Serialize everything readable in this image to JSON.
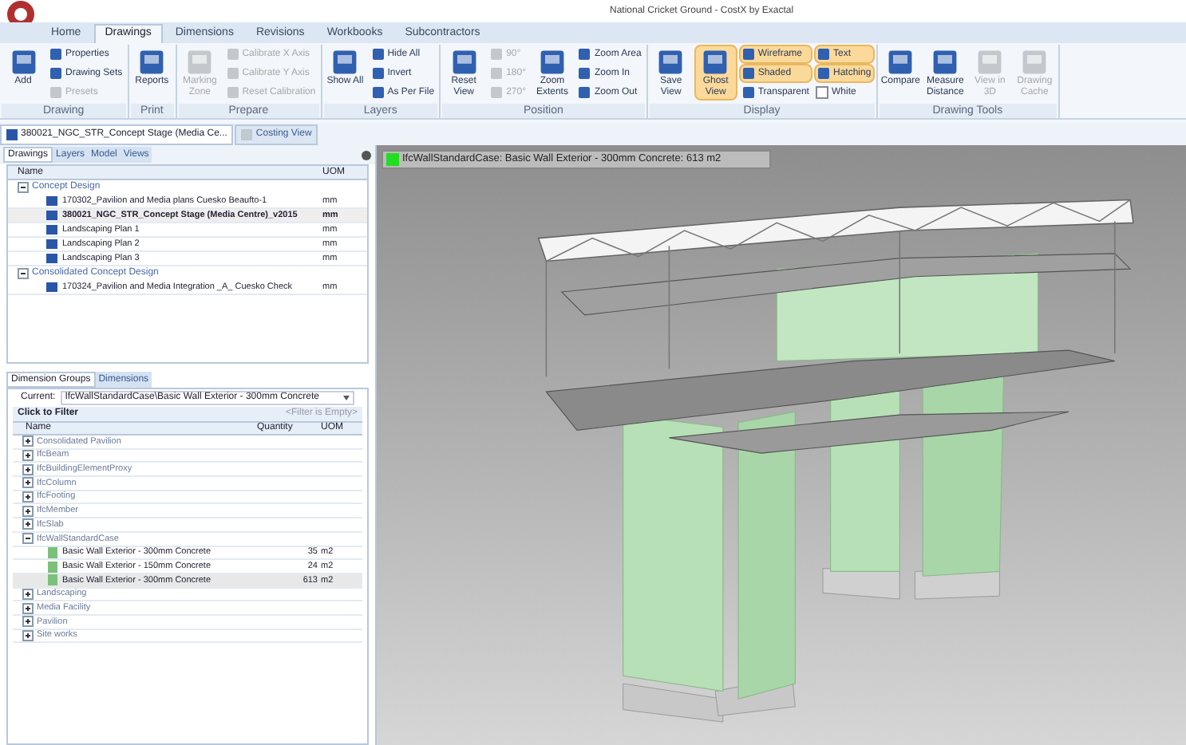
{
  "window": {
    "title": "National Cricket Ground - CostX by Exactal"
  },
  "ribbon_tabs": [
    {
      "label": "Home",
      "selected": false
    },
    {
      "label": "Drawings",
      "selected": true
    },
    {
      "label": "Dimensions",
      "selected": false
    },
    {
      "label": "Revisions",
      "selected": false
    },
    {
      "label": "Workbooks",
      "selected": false
    },
    {
      "label": "Subcontractors",
      "selected": false
    }
  ],
  "ribbon_groups": [
    {
      "label": "Drawing",
      "items": [
        {
          "kind": "large",
          "label": "Add",
          "disabled": false,
          "active": false
        },
        {
          "kind": "small",
          "label": "Properties",
          "disabled": false,
          "active": false
        },
        {
          "kind": "small",
          "label": "Drawing Sets",
          "disabled": false,
          "active": false
        },
        {
          "kind": "small",
          "label": "Presets",
          "disabled": true,
          "active": false
        }
      ]
    },
    {
      "label": "Print",
      "items": [
        {
          "kind": "large",
          "label": "Reports",
          "disabled": false,
          "active": false
        }
      ]
    },
    {
      "label": "Prepare",
      "items": [
        {
          "kind": "large",
          "label": "Marking Zone",
          "disabled": true,
          "active": false
        },
        {
          "kind": "small",
          "label": "Calibrate X Axis",
          "disabled": true,
          "active": false
        },
        {
          "kind": "small",
          "label": "Calibrate Y Axis",
          "disabled": true,
          "active": false
        },
        {
          "kind": "small",
          "label": "Reset Calibration",
          "disabled": true,
          "active": false
        }
      ]
    },
    {
      "label": "Layers",
      "items": [
        {
          "kind": "large",
          "label": "Show All",
          "disabled": false,
          "active": false
        },
        {
          "kind": "small",
          "label": "Hide All",
          "disabled": false,
          "active": false
        },
        {
          "kind": "small",
          "label": "Invert",
          "disabled": false,
          "active": false
        },
        {
          "kind": "small",
          "label": "As Per File",
          "disabled": false,
          "active": false
        }
      ]
    },
    {
      "label": "Position",
      "items": [
        {
          "kind": "large",
          "label": "Reset View",
          "disabled": false,
          "active": false
        },
        {
          "kind": "small",
          "label": "90°",
          "disabled": true,
          "active": false
        },
        {
          "kind": "small",
          "label": "180°",
          "disabled": true,
          "active": false
        },
        {
          "kind": "small",
          "label": "270°",
          "disabled": true,
          "active": false
        },
        {
          "kind": "large",
          "label": "Zoom Extents",
          "disabled": false,
          "active": false
        },
        {
          "kind": "small",
          "label": "Zoom Area",
          "disabled": false,
          "active": false
        },
        {
          "kind": "small",
          "label": "Zoom In",
          "disabled": false,
          "active": false
        },
        {
          "kind": "small",
          "label": "Zoom Out",
          "disabled": false,
          "active": false
        }
      ]
    },
    {
      "label": "Display",
      "items": [
        {
          "kind": "large",
          "label": "Save View",
          "disabled": false,
          "active": false
        },
        {
          "kind": "large",
          "label": "Ghost View",
          "disabled": false,
          "active": true
        },
        {
          "kind": "small",
          "label": "Wireframe",
          "disabled": false,
          "active": true
        },
        {
          "kind": "small",
          "label": "Shaded",
          "disabled": false,
          "active": true
        },
        {
          "kind": "small",
          "label": "Transparent",
          "disabled": false,
          "active": false
        },
        {
          "kind": "small",
          "label": "Text",
          "disabled": false,
          "active": true
        },
        {
          "kind": "small",
          "label": "Hatching",
          "disabled": false,
          "active": true
        },
        {
          "kind": "check",
          "label": "White",
          "checked": false
        }
      ]
    },
    {
      "label": "Drawing Tools",
      "items": [
        {
          "kind": "large",
          "label": "Compare",
          "disabled": false,
          "active": false
        },
        {
          "kind": "large",
          "label": "Measure Distance",
          "disabled": false,
          "active": false
        },
        {
          "kind": "large",
          "label": "View in 3D",
          "disabled": true,
          "active": false
        },
        {
          "kind": "large",
          "label": "Drawing Cache",
          "disabled": true,
          "active": false
        }
      ]
    }
  ],
  "document_tabs": [
    {
      "label": "380021_NGC_STR_Concept Stage (Media Ce...",
      "selected": true
    },
    {
      "label": "Costing View",
      "selected": false
    }
  ],
  "drawings_panel": {
    "tabs": [
      {
        "label": "Drawings",
        "selected": true
      },
      {
        "label": "Layers",
        "selected": false
      },
      {
        "label": "Model",
        "selected": false
      },
      {
        "label": "Views",
        "selected": false
      }
    ],
    "columns": [
      "Name",
      "UOM"
    ],
    "groups": [
      {
        "label": "Concept Design",
        "expanded": true,
        "children": [
          {
            "name": "170302_Pavilion and Media plans Cuesko Beaufto-1",
            "uom": "mm",
            "selected": false
          },
          {
            "name": "380021_NGC_STR_Concept Stage (Media Centre)_v2015",
            "uom": "mm",
            "selected": true
          },
          {
            "name": "Landscaping Plan 1",
            "uom": "mm",
            "selected": false
          },
          {
            "name": "Landscaping Plan 2",
            "uom": "mm",
            "selected": false
          },
          {
            "name": "Landscaping Plan 3",
            "uom": "mm",
            "selected": false
          }
        ]
      },
      {
        "label": "Consolidated Concept Design",
        "expanded": true,
        "children": [
          {
            "name": "170324_Pavilion and Media Integration _A_ Cuesko Check",
            "uom": "mm",
            "selected": false
          }
        ]
      }
    ]
  },
  "dimensions_panel": {
    "tabs": [
      {
        "label": "Dimension Groups",
        "selected": true
      },
      {
        "label": "Dimensions",
        "selected": false
      }
    ],
    "current_label": "Current:",
    "current_value": "IfcWallStandardCase\\Basic Wall Exterior - 300mm Concrete",
    "filter_label": "Click to Filter",
    "filter_hint": "<Filter is Empty>",
    "columns": [
      "Name",
      "Quantity",
      "UOM"
    ],
    "groups": [
      {
        "label": "Consolidated Pavilion",
        "expanded": false
      },
      {
        "label": "IfcBeam",
        "expanded": false
      },
      {
        "label": "IfcBuildingElementProxy",
        "expanded": false
      },
      {
        "label": "IfcColumn",
        "expanded": false
      },
      {
        "label": "IfcFooting",
        "expanded": false
      },
      {
        "label": "IfcMember",
        "expanded": false
      },
      {
        "label": "IfcSlab",
        "expanded": false
      },
      {
        "label": "IfcWallStandardCase",
        "expanded": true,
        "children": [
          {
            "name": "Basic Wall Exterior - 300mm Concrete",
            "quantity": "35",
            "uom": "m2",
            "selected": false
          },
          {
            "name": "Basic Wall Exterior - 150mm Concrete",
            "quantity": "24",
            "uom": "m2",
            "selected": false
          },
          {
            "name": "Basic Wall Exterior - 300mm Concrete",
            "quantity": "613",
            "uom": "m2",
            "selected": true
          }
        ]
      },
      {
        "label": "Landscaping",
        "expanded": false
      },
      {
        "label": "Media Facility",
        "expanded": false
      },
      {
        "label": "Pavilion",
        "expanded": false
      },
      {
        "label": "Site works",
        "expanded": false
      }
    ]
  },
  "viewport": {
    "label": "IfcWallStandardCase: Basic Wall Exterior - 300mm Concrete: 613 m2",
    "color": "#22dd22"
  }
}
